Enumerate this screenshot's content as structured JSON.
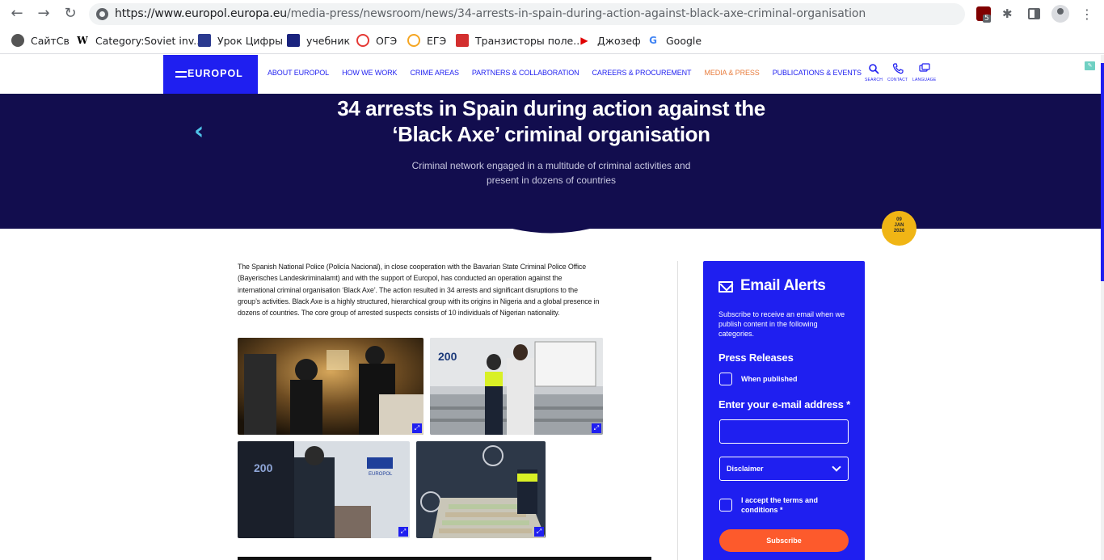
{
  "browser": {
    "url_host": "https://www.europol.europa.eu",
    "url_path": "/media-press/newsroom/news/34-arrests-in-spain-during-action-against-black-axe-criminal-organisation",
    "extension_badge": "5",
    "bookmarks": [
      {
        "label": "СайтСв",
        "icon": "raccoon-icon"
      },
      {
        "label": "Category:Soviet inv...",
        "icon": "wikipedia-icon"
      },
      {
        "label": "Урок Цифры",
        "icon": "urok-cifry-icon"
      },
      {
        "label": "учебник",
        "icon": "book-icon"
      },
      {
        "label": "ОГЭ",
        "icon": "oge-icon"
      },
      {
        "label": "ЕГЭ",
        "icon": "ege-icon"
      },
      {
        "label": "Транзисторы поле...",
        "icon": "transistor-icon"
      },
      {
        "label": "Джозеф",
        "icon": "play-icon"
      },
      {
        "label": "Google",
        "icon": "google-icon"
      }
    ]
  },
  "site": {
    "logo_text": "EUROPOL",
    "nav": [
      {
        "label": "ABOUT EUROPOL",
        "active": false
      },
      {
        "label": "HOW WE WORK",
        "active": false
      },
      {
        "label": "CRIME AREAS",
        "active": false
      },
      {
        "label": "PARTNERS & COLLABORATION",
        "active": false
      },
      {
        "label": "CAREERS & PROCUREMENT",
        "active": false
      },
      {
        "label": "MEDIA & PRESS",
        "active": true
      },
      {
        "label": "PUBLICATIONS & EVENTS",
        "active": false
      }
    ],
    "utilities": {
      "search": "SEARCH",
      "contact": "CONTACT",
      "language": "LANGUAGE"
    }
  },
  "hero": {
    "title_line1": "34 arrests in Spain during action against the",
    "title_line2": "‘Black Axe’ criminal organisation",
    "subtitle_line1": "Criminal network engaged in a multitude of criminal activities and",
    "subtitle_line2": "present in dozens of countries",
    "date": {
      "day": "09",
      "month": "JAN",
      "year": "2026"
    }
  },
  "article": {
    "lines": [
      "The Spanish National Police (Policía Nacional), in close cooperation with the Bavarian State Criminal Police Office",
      "(Bayerisches Landeskriminalamt) and with the support of Europol, has conducted an operation against the",
      "international criminal organisation ‘Black Axe’. The action resulted in 34 arrests and significant disruptions to the",
      "group’s activities. Black Axe is a highly structured, hierarchical group with its origins in Nigeria and a global presence in",
      "dozens of countries. The core group of arrested suspects consists of 10 individuals of Nigerian nationality."
    ]
  },
  "alerts": {
    "title": "Email Alerts",
    "desc": "Subscribe to receive an email when we publish content in the following categories.",
    "press_releases": "Press Releases",
    "when_published": "When published",
    "email_label": "Enter your e-mail address *",
    "disclaimer": "Disclaimer",
    "terms": "I accept the terms and conditions *",
    "subscribe": "Subscribe"
  },
  "colors": {
    "brand_blue": "#1f1ff0",
    "hero_navy": "#120d4e",
    "accent_orange": "#e87d3e",
    "subscribe": "#fd5a2c",
    "date_badge": "#f0b515"
  }
}
